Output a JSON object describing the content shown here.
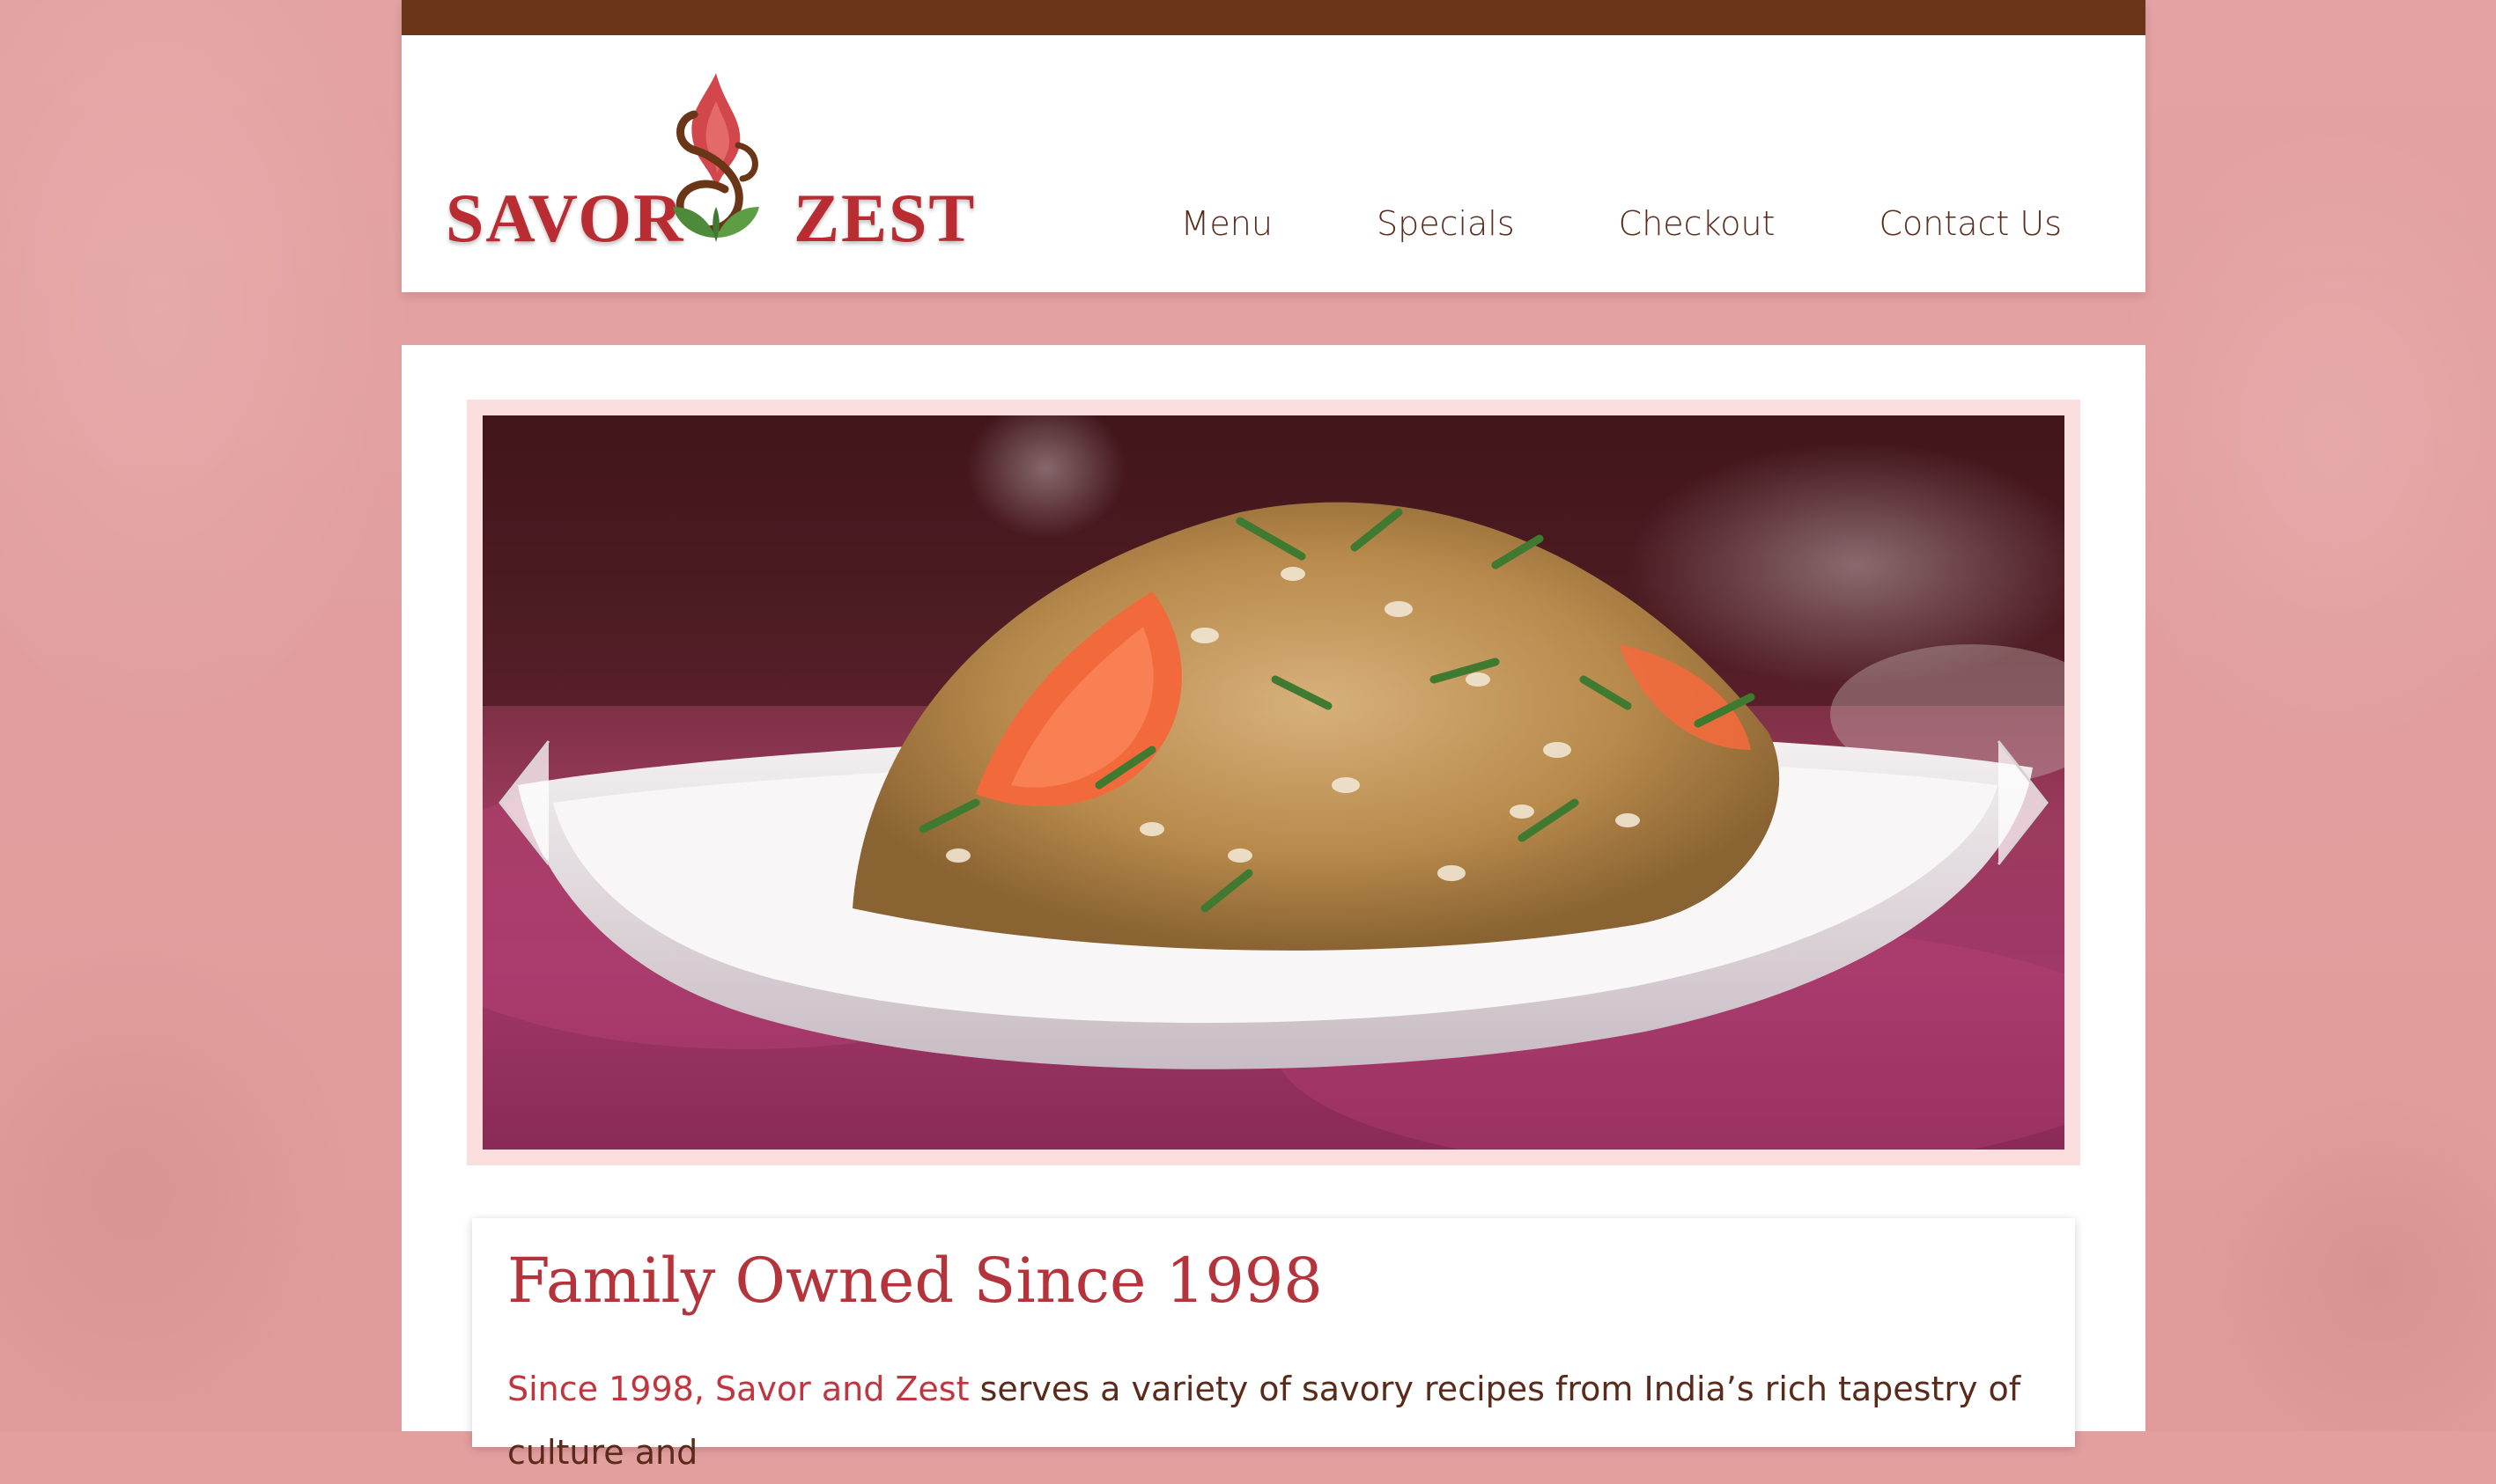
{
  "brand": {
    "name_left": "SAVOR",
    "name_right": "ZEST",
    "logo_icon": "flame-leaf-ampersand-icon",
    "colors": {
      "primary_red": "#b92d32",
      "brown": "#6b3517",
      "leaf_green": "#4d8a3a",
      "background_pink": "#e39e9e",
      "frame_pink": "#fbdede"
    }
  },
  "nav": {
    "items": [
      {
        "label": "Menu"
      },
      {
        "label": "Specials"
      },
      {
        "label": "Checkout"
      },
      {
        "label": "Contact Us"
      }
    ]
  },
  "slider": {
    "image_alt": "",
    "prev_icon": "chevron-left-icon",
    "next_icon": "chevron-right-icon"
  },
  "intro": {
    "title": "Family Owned Since 1998",
    "highlight": "Since 1998, Savor and Zest",
    "body": " serves a variety of savory recipes from India’s rich tapestry of culture and"
  }
}
